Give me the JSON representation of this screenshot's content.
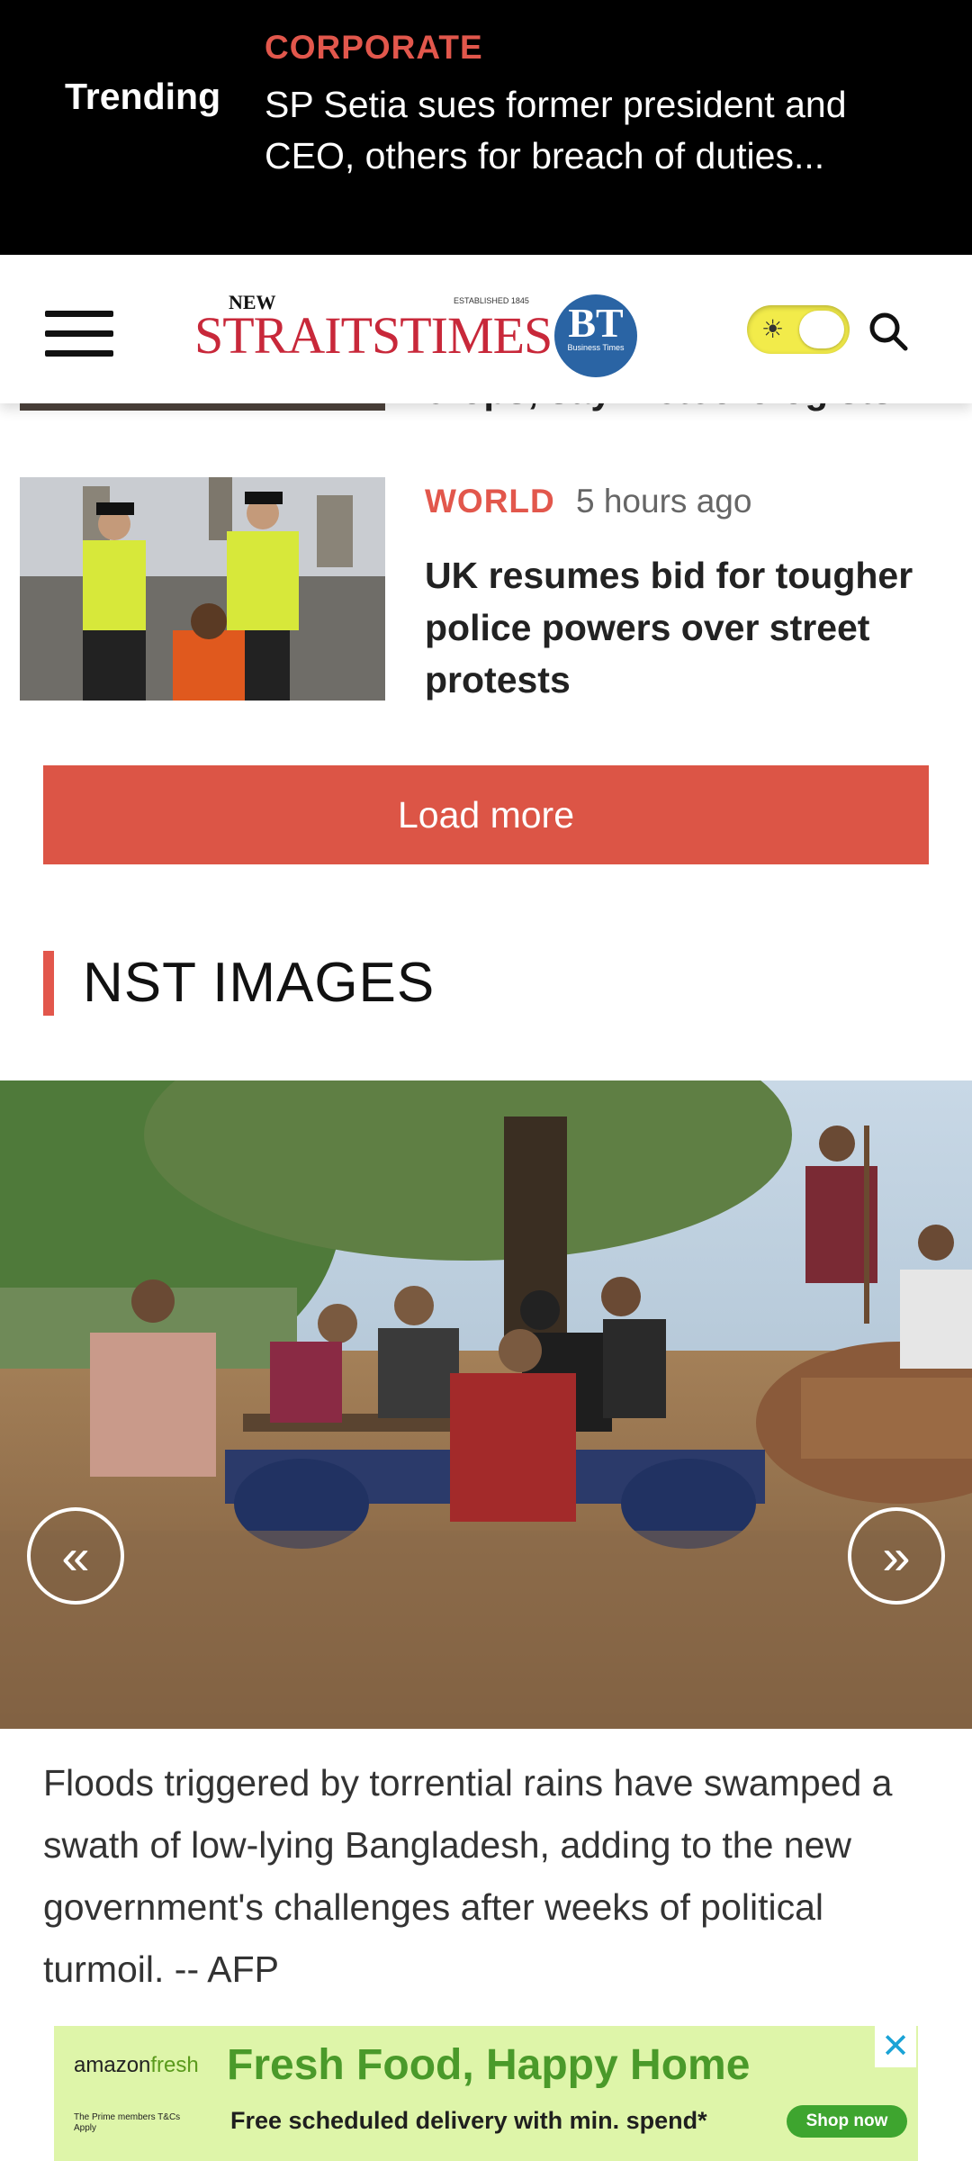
{
  "trending": {
    "label": "Trending",
    "category": "CORPORATE",
    "headline": "SP Setia sues former president and CEO, others for breach of duties..."
  },
  "header": {
    "logo_new": "NEW",
    "logo_est": "ESTABLISHED 1845",
    "logo_main": "STRAITSTIMES",
    "bt_badge": "BT",
    "bt_badge_sub": "Business Times",
    "accent_color": "#e2574c"
  },
  "previous_article": {
    "partial_title": "crops, say meteorologists"
  },
  "article": {
    "category": "WORLD",
    "time": "5 hours ago",
    "title": "UK resumes bid for tougher police powers over street protests"
  },
  "load_more_label": "Load more",
  "section": {
    "title": "NST IMAGES"
  },
  "gallery": {
    "prev_label": "«",
    "next_label": "»",
    "caption": "Floods triggered by torrential rains have swamped a swath of low-lying Bangladesh, adding to the new government's challenges after weeks of political turmoil. -- AFP"
  },
  "ad": {
    "brand_amazon": "amazon",
    "brand_fresh": "fresh",
    "small_print": "The Prime members T&Cs Apply",
    "title": "Fresh Food, Happy Home",
    "subtitle": "Free scheduled delivery with min. spend*",
    "shop_label": "Shop now",
    "close_label": "✕"
  }
}
